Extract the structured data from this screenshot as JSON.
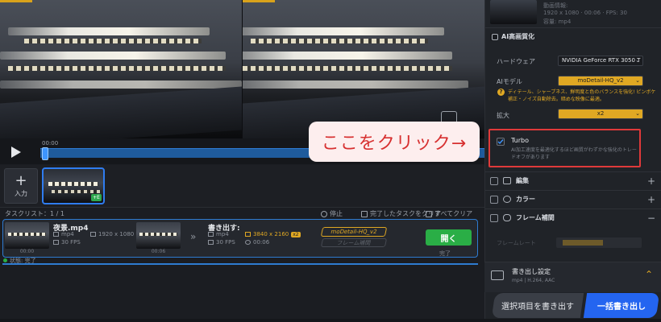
{
  "preview": {
    "compare_icon": "split-view-icon"
  },
  "timeline": {
    "time": "00:00",
    "play_icon": "play-icon"
  },
  "callout": {
    "text": "ここをクリック→"
  },
  "media": {
    "add_label": "入力",
    "thumb_badge": "+E"
  },
  "tasklist": {
    "title": "タスクリスト：1 / 1",
    "stop": "停止",
    "clear_done": "完了したタスクをクリア",
    "clear_all": "すべてクリア"
  },
  "task": {
    "source": {
      "name": "夜景.mp4",
      "format": "mp4",
      "resolution": "1920 x 1080",
      "fps": "30 FPS",
      "thumb_time_1": "00:00",
      "thumb_time_2": "00:06"
    },
    "output": {
      "title": "書き出す:",
      "format": "mp4",
      "resolution": "3840 x 2160",
      "badge": "x2",
      "fps": "30 FPS",
      "duration": "00:06"
    },
    "model_tag": "moDetail-HQ_v2",
    "frame_tag": "フレーム補間",
    "open_button": "開く",
    "done_label": "完了",
    "status": "状態: 完了"
  },
  "panel": {
    "info": {
      "label": "動画情報:",
      "line1": "1920 x 1080 · 00:06 · FPS: 30",
      "line2": "容量: mp4"
    },
    "ai_section": {
      "title": "AI高画質化"
    },
    "hardware": {
      "label": "ハードウェア",
      "value": "NVIDIA GeForce RTX 3050 T"
    },
    "ai_model": {
      "label": "AIモデル",
      "value": "moDetail-HQ_v2"
    },
    "hint": "ディテール、シャープネス、鮮明度と色のバランスを強化! ピンボケ補正・ノイズ自動除去。暗めな映像に最適。",
    "scale": {
      "label": "拡大",
      "value": "x2"
    },
    "turbo": {
      "title": "Turbo",
      "desc": "AI加工速度を最適化するほど画質がわずかな強化のトレードオフがあります"
    },
    "sections": [
      {
        "title": "編集",
        "icon": "edit-icon",
        "sign": "+"
      },
      {
        "title": "カラー",
        "icon": "palette-icon",
        "sign": "+"
      },
      {
        "title": "フレーム補間",
        "icon": "frame-interp-icon",
        "sign": "−"
      }
    ],
    "frame_rate_label": "フレームレート",
    "export": {
      "title": "書き出し設定",
      "sub": "mp4 | H.264, AAC"
    },
    "buttons": {
      "export_selected": "選択項目を書き出す",
      "export_all": "一括書き出し"
    }
  },
  "colors": {
    "accent": "#2465f0",
    "gold": "#e0a823",
    "highlight": "#e03a3a",
    "green": "#2aae46"
  }
}
